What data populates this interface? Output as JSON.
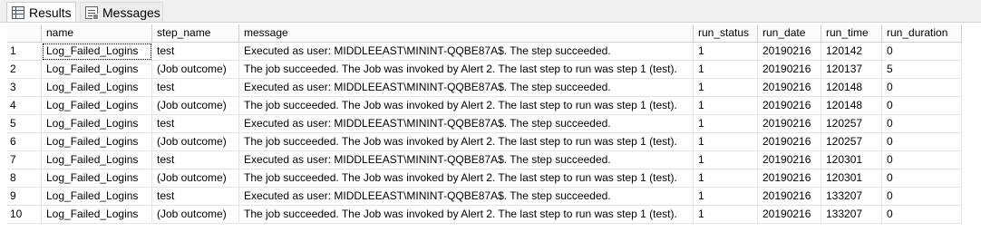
{
  "tabs": [
    {
      "label": "Results",
      "icon": "grid-icon",
      "active": true
    },
    {
      "label": "Messages",
      "icon": "messages-icon",
      "active": false
    }
  ],
  "columns": [
    "name",
    "step_name",
    "message",
    "run_status",
    "run_date",
    "run_time",
    "run_duration"
  ],
  "rows": [
    {
      "n": "1",
      "name": "Log_Failed_Logins",
      "step_name": "test",
      "message": "Executed as user: MIDDLEEAST\\MININT-QQBE87A$. The step succeeded.",
      "run_status": "1",
      "run_date": "20190216",
      "run_time": "120142",
      "run_duration": "0"
    },
    {
      "n": "2",
      "name": "Log_Failed_Logins",
      "step_name": "(Job outcome)",
      "message": "The job succeeded.  The Job was invoked by Alert 2.  The last step to run was step 1 (test).",
      "run_status": "1",
      "run_date": "20190216",
      "run_time": "120137",
      "run_duration": "5"
    },
    {
      "n": "3",
      "name": "Log_Failed_Logins",
      "step_name": "test",
      "message": "Executed as user: MIDDLEEAST\\MININT-QQBE87A$. The step succeeded.",
      "run_status": "1",
      "run_date": "20190216",
      "run_time": "120148",
      "run_duration": "0"
    },
    {
      "n": "4",
      "name": "Log_Failed_Logins",
      "step_name": "(Job outcome)",
      "message": "The job succeeded.  The Job was invoked by Alert 2.  The last step to run was step 1 (test).",
      "run_status": "1",
      "run_date": "20190216",
      "run_time": "120148",
      "run_duration": "0"
    },
    {
      "n": "5",
      "name": "Log_Failed_Logins",
      "step_name": "test",
      "message": "Executed as user: MIDDLEEAST\\MININT-QQBE87A$. The step succeeded.",
      "run_status": "1",
      "run_date": "20190216",
      "run_time": "120257",
      "run_duration": "0"
    },
    {
      "n": "6",
      "name": "Log_Failed_Logins",
      "step_name": "(Job outcome)",
      "message": "The job succeeded.  The Job was invoked by Alert 2.  The last step to run was step 1 (test).",
      "run_status": "1",
      "run_date": "20190216",
      "run_time": "120257",
      "run_duration": "0"
    },
    {
      "n": "7",
      "name": "Log_Failed_Logins",
      "step_name": "test",
      "message": "Executed as user: MIDDLEEAST\\MININT-QQBE87A$. The step succeeded.",
      "run_status": "1",
      "run_date": "20190216",
      "run_time": "120301",
      "run_duration": "0"
    },
    {
      "n": "8",
      "name": "Log_Failed_Logins",
      "step_name": "(Job outcome)",
      "message": "The job succeeded.  The Job was invoked by Alert 2.  The last step to run was step 1 (test).",
      "run_status": "1",
      "run_date": "20190216",
      "run_time": "120301",
      "run_duration": "0"
    },
    {
      "n": "9",
      "name": "Log_Failed_Logins",
      "step_name": "test",
      "message": "Executed as user: MIDDLEEAST\\MININT-QQBE87A$. The step succeeded.",
      "run_status": "1",
      "run_date": "20190216",
      "run_time": "133207",
      "run_duration": "0"
    },
    {
      "n": "10",
      "name": "Log_Failed_Logins",
      "step_name": "(Job outcome)",
      "message": "The job succeeded.  The Job was invoked by Alert 2.  The last step to run was step 1 (test).",
      "run_status": "1",
      "run_date": "20190216",
      "run_time": "133207",
      "run_duration": "0"
    }
  ]
}
